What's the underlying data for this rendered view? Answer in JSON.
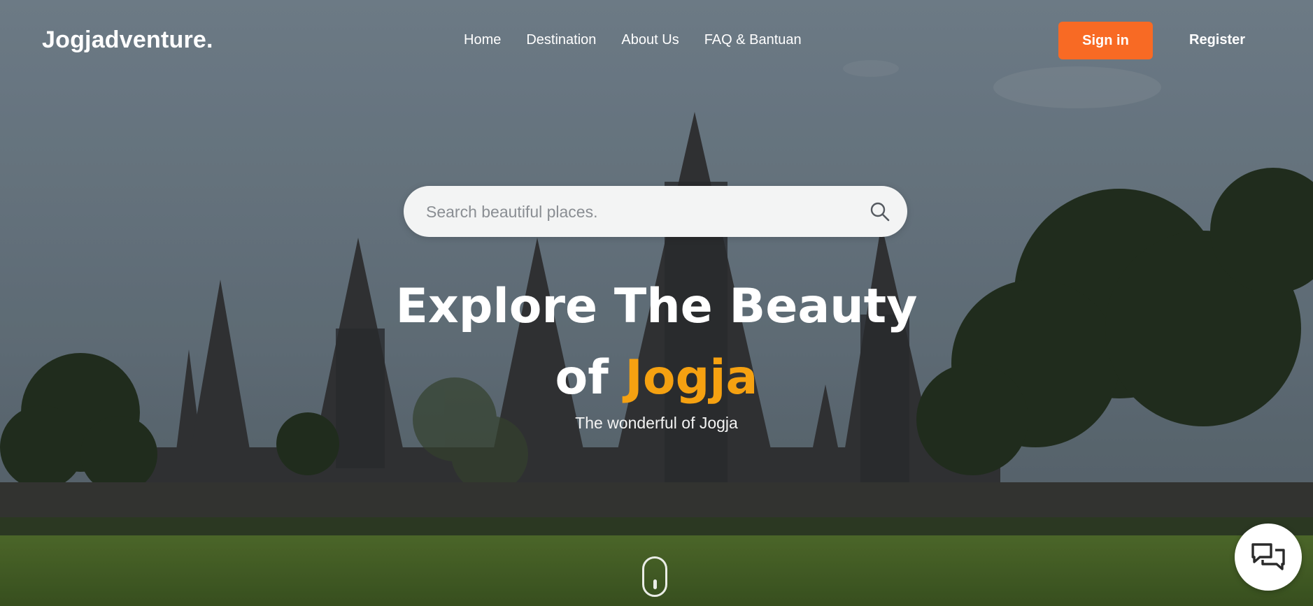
{
  "brand": {
    "name": "Jogjadventure."
  },
  "nav": {
    "items": [
      {
        "label": "Home"
      },
      {
        "label": "Destination"
      },
      {
        "label": "About Us"
      },
      {
        "label": "FAQ & Bantuan"
      }
    ]
  },
  "auth": {
    "signin_label": "Sign in",
    "register_label": "Register"
  },
  "search": {
    "placeholder": "Search beautiful places.",
    "icon": "search-icon"
  },
  "hero": {
    "title_line1": "Explore The Beauty",
    "title_line2_prefix": "of",
    "title_line2_accent": "Jogja",
    "subtitle": "The wonderful of Jogja"
  },
  "widgets": {
    "chat_icon": "chat-icon",
    "scroll_icon": "scroll-mouse-icon"
  },
  "colors": {
    "accent": "#f86a24",
    "highlight": "#f5a111",
    "sky": "#7a8a97",
    "grass": "#4e6b2f"
  }
}
